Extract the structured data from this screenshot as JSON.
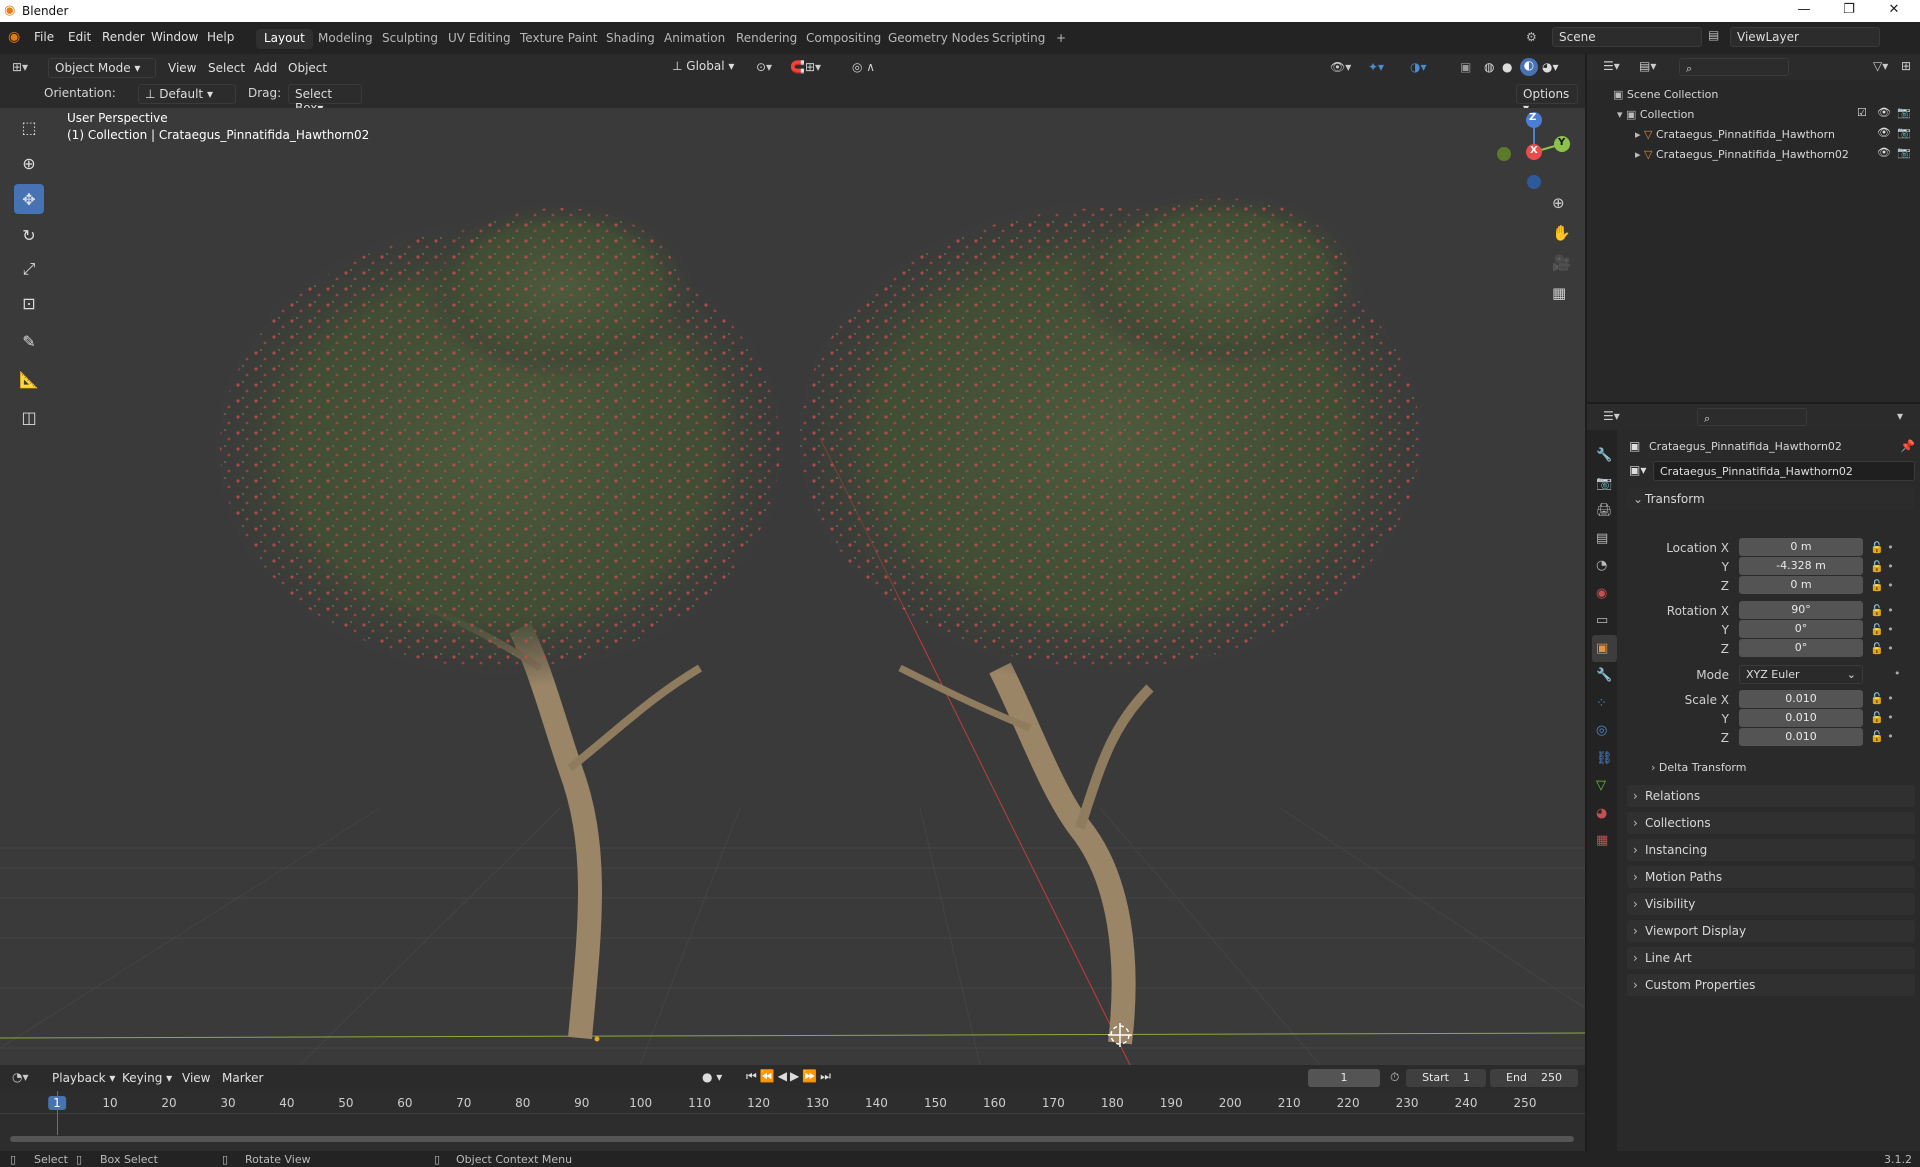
{
  "app": {
    "title": "Blender",
    "version": "3.1.2"
  },
  "menus": [
    "File",
    "Edit",
    "Render",
    "Window",
    "Help"
  ],
  "workspaces": [
    "Layout",
    "Modeling",
    "Sculpting",
    "UV Editing",
    "Texture Paint",
    "Shading",
    "Animation",
    "Rendering",
    "Compositing",
    "Geometry Nodes",
    "Scripting",
    "+"
  ],
  "active_workspace": "Layout",
  "scene": {
    "label": "Scene",
    "view_layer": "ViewLayer"
  },
  "viewport_header": {
    "mode": "Object Mode",
    "menus": [
      "View",
      "Select",
      "Add",
      "Object"
    ],
    "transform_space": "Global",
    "orientation_label": "Orientation:",
    "orientation_value": "Default",
    "drag_label": "Drag:",
    "drag_value": "Select Box",
    "options": "Options"
  },
  "viewport": {
    "perspective": "User Perspective",
    "collection_info": "(1) Collection | Crataegus_Pinnatifida_Hawthorn02",
    "gizmo": {
      "x": "X",
      "y": "Y",
      "z": "Z"
    }
  },
  "outliner": {
    "root": "Scene Collection",
    "collection": "Collection",
    "items": [
      "Crataegus_Pinnatifida_Hawthorn",
      "Crataegus_Pinnatifida_Hawthorn02"
    ]
  },
  "properties": {
    "object_name": "Crataegus_Pinnatifida_Hawthorn02",
    "data_name": "Crataegus_Pinnatifida_Hawthorn02",
    "transform_title": "Transform",
    "location_label": "Location X",
    "location": [
      "0 m",
      "-4.328 m",
      "0 m"
    ],
    "rotation_label": "Rotation X",
    "rotation": [
      "90°",
      "0°",
      "0°"
    ],
    "mode_label": "Mode",
    "mode_value": "XYZ Euler",
    "scale_label": "Scale X",
    "scale": [
      "0.010",
      "0.010",
      "0.010"
    ],
    "y_label": "Y",
    "z_label": "Z",
    "delta_transform": "Delta Transform",
    "panels": [
      "Relations",
      "Collections",
      "Instancing",
      "Motion Paths",
      "Visibility",
      "Viewport Display",
      "Line Art",
      "Custom Properties"
    ]
  },
  "timeline": {
    "menus": [
      "Playback",
      "Keying",
      "View",
      "Marker"
    ],
    "current_frame": "1",
    "start_label": "Start",
    "start": "1",
    "end_label": "End",
    "end": "250",
    "ticks": [
      "1",
      "10",
      "20",
      "30",
      "40",
      "50",
      "60",
      "70",
      "80",
      "90",
      "100",
      "110",
      "120",
      "130",
      "140",
      "150",
      "160",
      "170",
      "180",
      "190",
      "200",
      "210",
      "220",
      "230",
      "240",
      "250"
    ]
  },
  "statusbar": {
    "select": "Select",
    "box_select": "Box Select",
    "rotate_view": "Rotate View",
    "context_menu": "Object Context Menu"
  },
  "colors": {
    "accent": "#4772b3",
    "x_axis": "#e84c4c",
    "y_axis": "#8bc34a",
    "z_axis": "#4a7fd4",
    "bg": "#3a3a3a"
  }
}
